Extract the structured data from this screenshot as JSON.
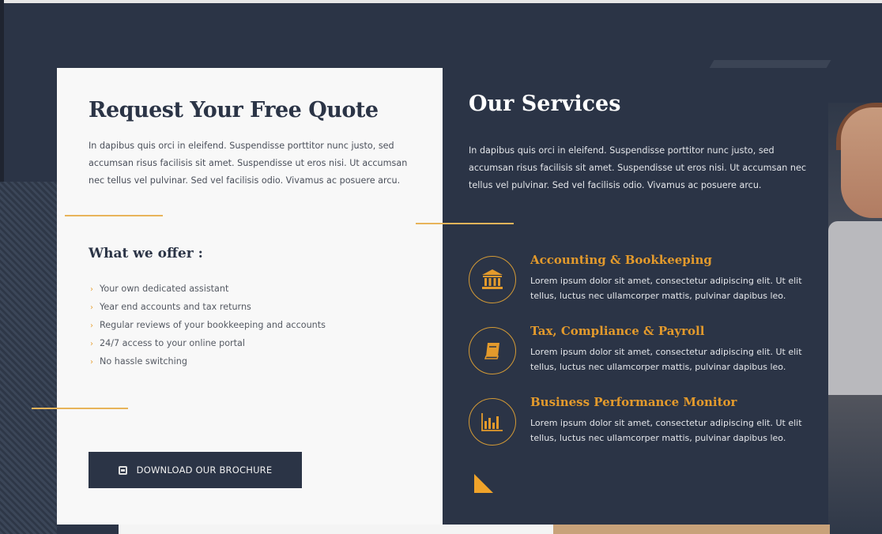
{
  "colors": {
    "navy": "#2b3446",
    "accent": "#e39a2c",
    "card": "#f8f8f8"
  },
  "quote": {
    "title": "Request Your Free Quote",
    "text": "In dapibus quis orci in eleifend. Suspendisse porttitor nunc justo, sed accumsan risus facilisis sit amet. Suspendisse ut eros nisi. Ut accumsan nec tellus vel pulvinar. Sed vel facilisis odio. Vivamus ac posuere arcu.",
    "offer_title": "What we offer :",
    "offers": [
      "Your own dedicated assistant",
      "Year end accounts and tax returns",
      "Regular reviews of your bookkeeping and accounts",
      "24/7 access to your online portal",
      "No hassle switching"
    ],
    "brochure_label": "DOWNLOAD OUR BROCHURE",
    "brochure_icon": "download-icon"
  },
  "services": {
    "title": "Our Services",
    "text": "In dapibus quis orci in eleifend. Suspendisse porttitor nunc justo, sed accumsan risus facilisis sit amet. Suspendisse ut eros nisi. Ut accumsan nec tellus vel pulvinar. Sed vel facilisis odio. Vivamus ac posuere arcu.",
    "items": [
      {
        "title": "Accounting & Bookkeeping",
        "desc": "Lorem ipsum dolor sit amet, consectetur adipiscing elit. Ut elit tellus, luctus nec ullamcorper mattis, pulvinar dapibus leo.",
        "icon": "bank-icon"
      },
      {
        "title": "Tax, Compliance & Payroll",
        "desc": "Lorem ipsum dolor sit amet, consectetur adipiscing elit. Ut elit tellus, luctus nec ullamcorper mattis, pulvinar dapibus leo.",
        "icon": "book-icon"
      },
      {
        "title": "Business Performance Monitor",
        "desc": "Lorem ipsum dolor sit amet, consectetur adipiscing elit. Ut elit tellus, luctus nec ullamcorper mattis, pulvinar dapibus leo.",
        "icon": "bar-chart-icon"
      }
    ]
  }
}
